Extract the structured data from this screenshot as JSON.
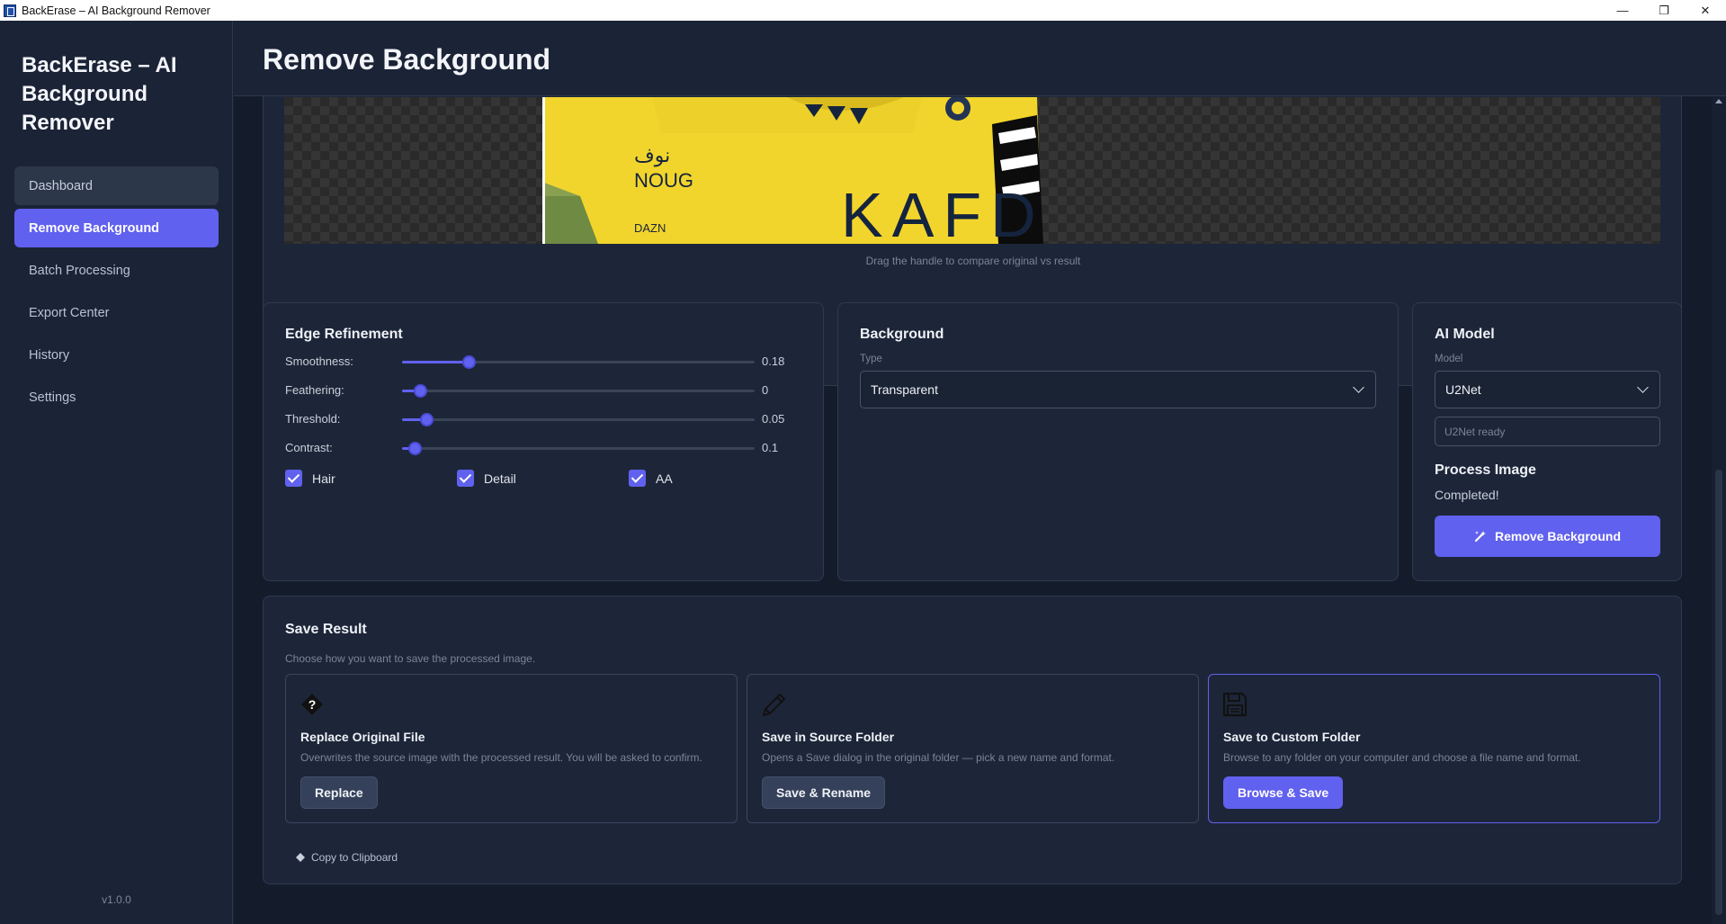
{
  "window": {
    "title": "BackErase – AI Background Remover",
    "controls": {
      "minimize": "—",
      "restore": "❐",
      "close": "✕"
    }
  },
  "sidebar": {
    "brand": "BackErase – AI Background Remover",
    "items": [
      {
        "label": "Dashboard",
        "state": "hover"
      },
      {
        "label": "Remove Background",
        "state": "active"
      },
      {
        "label": "Batch Processing",
        "state": ""
      },
      {
        "label": "Export Center",
        "state": ""
      },
      {
        "label": "History",
        "state": ""
      },
      {
        "label": "Settings",
        "state": ""
      }
    ],
    "version": "v1.0.0"
  },
  "header": {
    "title": "Remove Background"
  },
  "preview": {
    "hint": "Drag the handle to compare original vs result",
    "jersey_text": {
      "sponsor": "KAFD",
      "arabic": "نوف",
      "badge": "NOUG",
      "dazn": "DAZN"
    }
  },
  "edge": {
    "title": "Edge Refinement",
    "sliders": [
      {
        "label": "Smoothness:",
        "value": "0.18",
        "level": 0.19
      },
      {
        "label": "Feathering:",
        "value": "0",
        "level": 0.05
      },
      {
        "label": "Threshold:",
        "value": "0.05",
        "level": 0.07
      },
      {
        "label": "Contrast:",
        "value": "0.1",
        "level": 0.035
      }
    ],
    "checks": [
      {
        "label": "Hair",
        "checked": true
      },
      {
        "label": "Detail",
        "checked": true
      },
      {
        "label": "AA",
        "checked": true
      }
    ]
  },
  "background": {
    "title": "Background",
    "type_label": "Type",
    "type_value": "Transparent"
  },
  "ai": {
    "title": "AI Model",
    "model_label": "Model",
    "model_value": "U2Net",
    "status": "U2Net ready",
    "process_title": "Process Image",
    "process_status": "Completed!",
    "button": "Remove Background"
  },
  "save": {
    "title": "Save Result",
    "subtitle": "Choose how you want to save the processed image.",
    "options": [
      {
        "icon": "diamond-question-icon",
        "title": "Replace Original File",
        "desc": "Overwrites the source image with the processed result. You will be asked to confirm.",
        "button": "Replace"
      },
      {
        "icon": "pencil-icon",
        "title": "Save in Source Folder",
        "desc": "Opens a Save dialog in the original folder — pick a new name and format.",
        "button": "Save & Rename"
      },
      {
        "icon": "floppy-disk-icon",
        "title": "Save to Custom Folder",
        "desc": "Browse to any folder on your computer and choose a file name and format.",
        "button": "Browse & Save"
      }
    ],
    "copy": "Copy to Clipboard"
  },
  "colors": {
    "accent": "#6161ef",
    "sidebar": "#1b2436",
    "content": "#141c2b",
    "card": "#1d2638"
  }
}
